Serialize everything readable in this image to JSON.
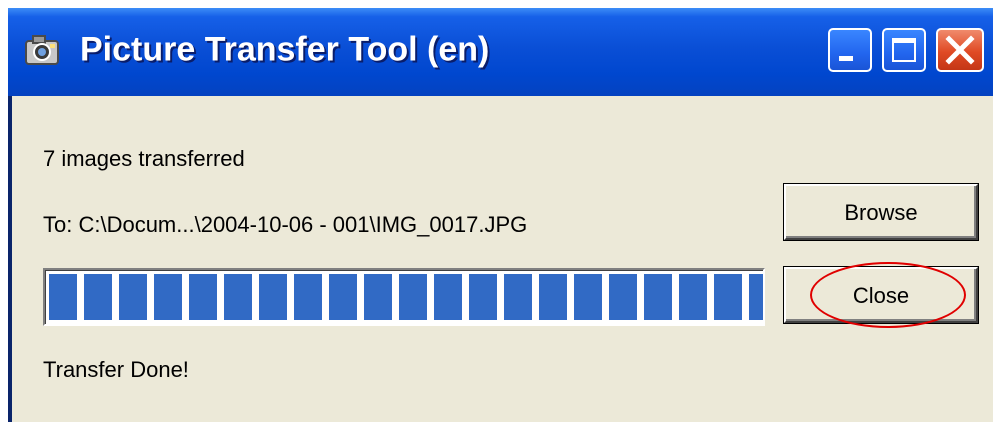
{
  "window": {
    "title": "Picture Transfer Tool (en)",
    "icon": "camera-icon",
    "controls": [
      "minimize-icon",
      "maximize-icon",
      "close-icon"
    ]
  },
  "transfer": {
    "count_text": "7 images transferred",
    "destination_text": "To: C:\\Docum...\\2004-10-06 - 001\\IMG_0017.JPG",
    "progress_percent": 100,
    "status_text": "Transfer Done!"
  },
  "buttons": {
    "browse_label": "Browse",
    "close_label": "Close"
  },
  "annotation": {
    "highlight_color": "#e00000"
  },
  "colors": {
    "titlebar": "#0047cf",
    "client": "#ece9d8",
    "progress_block": "#316ac5"
  }
}
